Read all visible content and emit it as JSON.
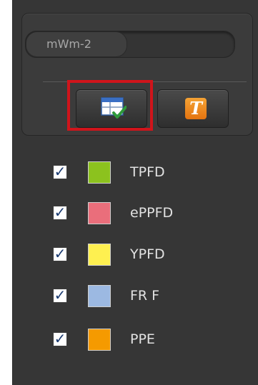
{
  "unit": {
    "label": "mWm-2"
  },
  "toolbar": {
    "table_icon": "table-check-icon",
    "text_icon": "text-t-icon",
    "text_glyph": "T"
  },
  "layers": [
    {
      "label": "TPFD",
      "color": "#8cc21e",
      "checked": true
    },
    {
      "label": "ePPFD",
      "color": "#ea6e7b",
      "checked": true
    },
    {
      "label": "YPFD",
      "color": "#fef050",
      "checked": true
    },
    {
      "label": "FR F",
      "color": "#9cb9e2",
      "checked": true
    },
    {
      "label": "PPE",
      "color": "#f59a00",
      "checked": true
    }
  ],
  "checkbox_glyph": "✓",
  "colors": {
    "highlight": "#d0141b",
    "panel": "#363636"
  }
}
